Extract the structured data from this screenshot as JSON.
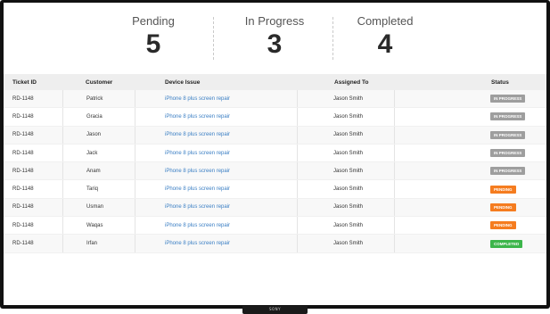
{
  "stats": [
    {
      "label": "Pending",
      "value": "5"
    },
    {
      "label": "In Progress",
      "value": "3"
    },
    {
      "label": "Completed",
      "value": "4"
    }
  ],
  "table": {
    "headers": {
      "ticket_id": "Ticket ID",
      "customer": "Customer",
      "device_issue": "Device Issue",
      "assigned_to": "Assigned To",
      "status": "Status"
    },
    "rows": [
      {
        "ticket_id": "RD-1148",
        "customer": "Patrick",
        "device_issue": "iPhone 8 plus screen repair",
        "assigned_to": "Jason Smith",
        "status": "IN PROGRESS",
        "status_color": "#9e9e9e"
      },
      {
        "ticket_id": "RD-1148",
        "customer": "Gracia",
        "device_issue": "iPhone 8 plus screen repair",
        "assigned_to": "Jason Smith",
        "status": "IN PROGRESS",
        "status_color": "#9e9e9e"
      },
      {
        "ticket_id": "RD-1148",
        "customer": "Jason",
        "device_issue": "iPhone 8 plus screen repair",
        "assigned_to": "Jason Smith",
        "status": "IN PROGRESS",
        "status_color": "#9e9e9e"
      },
      {
        "ticket_id": "RD-1148",
        "customer": "Jack",
        "device_issue": "iPhone 8 plus screen repair",
        "assigned_to": "Jason Smith",
        "status": "IN PROGRESS",
        "status_color": "#9e9e9e"
      },
      {
        "ticket_id": "RD-1148",
        "customer": "Anam",
        "device_issue": "iPhone 8 plus screen repair",
        "assigned_to": "Jason Smith",
        "status": "IN PROGRESS",
        "status_color": "#9e9e9e"
      },
      {
        "ticket_id": "RD-1148",
        "customer": "Tariq",
        "device_issue": "iPhone 8 plus screen repair",
        "assigned_to": "Jason Smith",
        "status": "PENDING",
        "status_color": "#f57c1f"
      },
      {
        "ticket_id": "RD-1148",
        "customer": "Usman",
        "device_issue": "iPhone 8 plus screen repair",
        "assigned_to": "Jason Smith",
        "status": "PENDING",
        "status_color": "#f57c1f"
      },
      {
        "ticket_id": "RD-1148",
        "customer": "Waqas",
        "device_issue": "iPhone 8 plus screen repair",
        "assigned_to": "Jason Smith",
        "status": "PENDING",
        "status_color": "#f57c1f"
      },
      {
        "ticket_id": "RD-1148",
        "customer": "Irfan",
        "device_issue": "iPhone 8 plus screen repair",
        "assigned_to": "Jason Smith",
        "status": "COMPLETED",
        "status_color": "#3cb54a"
      }
    ]
  },
  "monitor": {
    "brand": "SONY"
  }
}
